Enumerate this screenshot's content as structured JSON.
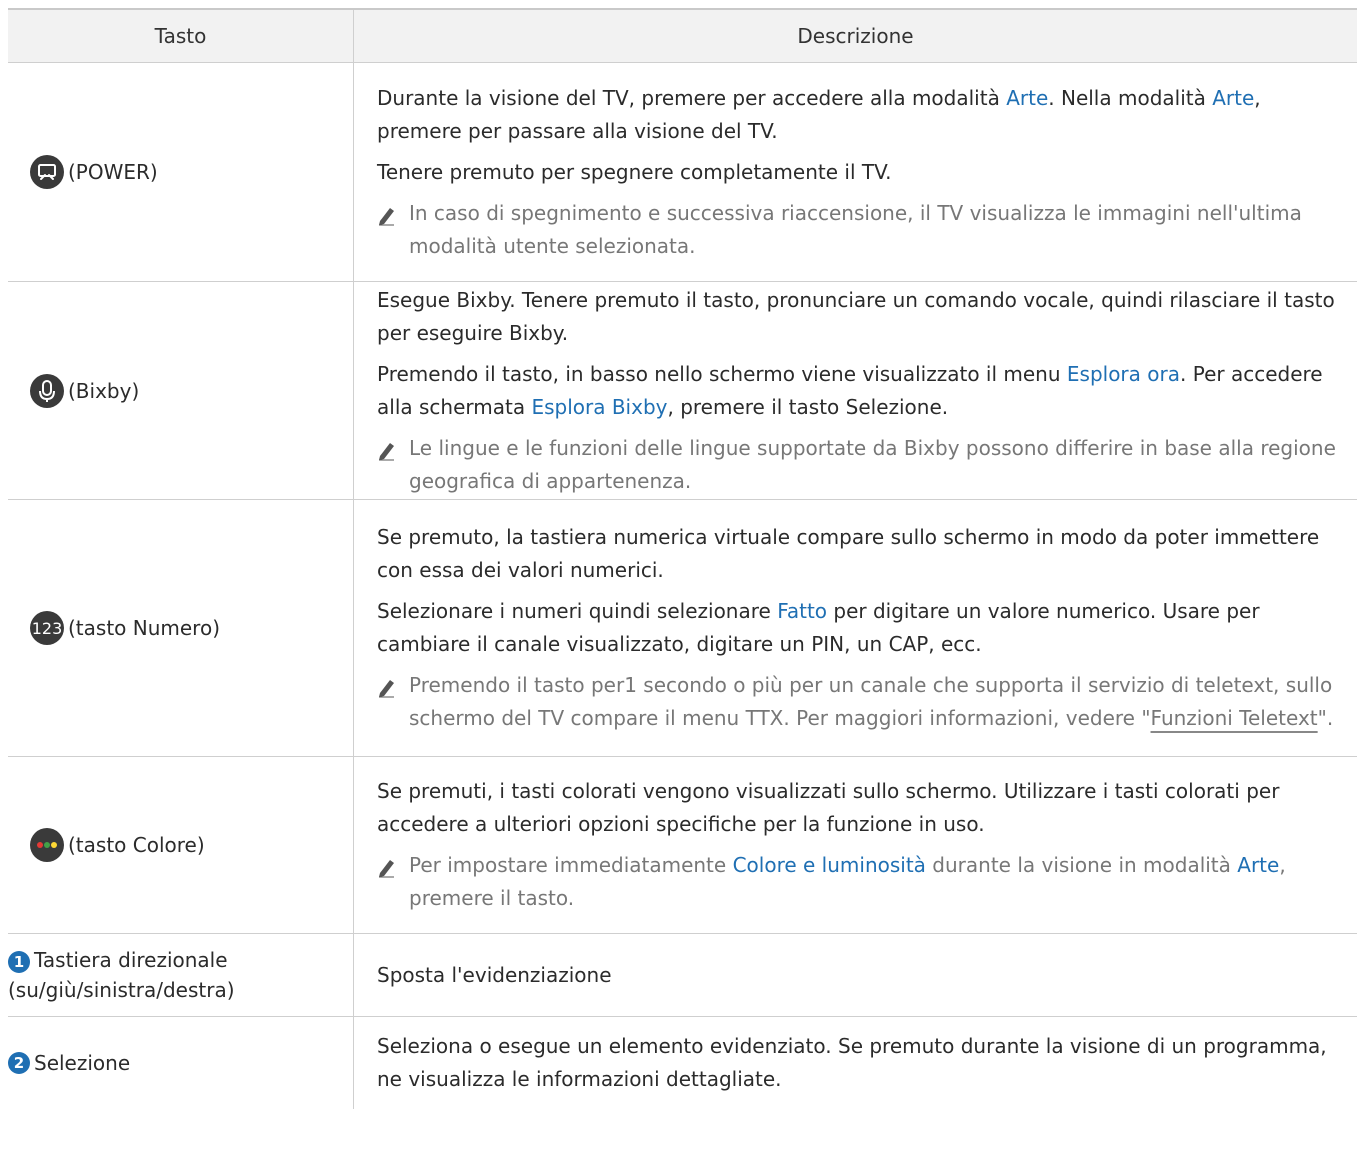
{
  "header": {
    "key_col": "Tasto",
    "desc_col": "Descrizione"
  },
  "rows": [
    {
      "key": "(POWER)",
      "icon": "art-mode-icon",
      "p1_a": "Durante la visione del TV, premere per accedere alla modalità ",
      "p1_link1": "Arte",
      "p1_b": ". Nella modalità ",
      "p1_link2": "Arte",
      "p1_c": ", premere per passare alla visione del TV.",
      "p2": "Tenere premuto per spegnere completamente il TV.",
      "note": "In caso di spegnimento e successiva riaccensione, il TV visualizza le immagini nell'ultima modalità utente selezionata."
    },
    {
      "key": "(Bixby)",
      "icon": "microphone-icon",
      "p1": "Esegue Bixby. Tenere premuto il tasto, pronunciare un comando vocale, quindi rilasciare il tasto per eseguire Bixby.",
      "p2_a": "Premendo il tasto, in basso nello schermo viene visualizzato il menu ",
      "p2_link1": "Esplora ora",
      "p2_b": ". Per accedere alla schermata ",
      "p2_link2": "Esplora Bixby",
      "p2_c": ", premere il tasto Selezione.",
      "note": "Le lingue e le funzioni delle lingue supportate da Bixby possono differire in base alla regione geografica di appartenenza."
    },
    {
      "key": "(tasto Numero)",
      "icon_text": "123",
      "p1": "Se premuto, la tastiera numerica virtuale compare sullo schermo in modo da poter immettere con essa dei valori numerici.",
      "p2_a": "Selezionare i numeri quindi selezionare ",
      "p2_link": "Fatto",
      "p2_b": " per digitare un valore numerico. Usare per cambiare il canale visualizzato, digitare un PIN, un CAP, ecc.",
      "note_a": "Premendo il tasto per1 secondo o più per un canale che supporta il servizio di teletext, sullo schermo del TV compare il menu TTX. Per maggiori informazioni, vedere \"",
      "note_link": "Funzioni Teletext",
      "note_b": "\"."
    },
    {
      "key": "(tasto Colore)",
      "icon": "color-dots-icon",
      "p1": "Se premuti, i tasti colorati vengono visualizzati sullo schermo. Utilizzare i tasti colorati per accedere a ulteriori opzioni specifiche per la funzione in uso.",
      "note_a": "Per impostare immediatamente ",
      "note_link1": "Colore e luminosità",
      "note_b": " durante la visione in modalità ",
      "note_link2": "Arte",
      "note_c": ", premere il tasto."
    },
    {
      "num": "1",
      "key": "Tastiera direzionale (su/giù/sinistra/destra)",
      "p1": "Sposta l'evidenziazione"
    },
    {
      "num": "2",
      "key": "Selezione",
      "p1": "Seleziona o esegue un elemento evidenziato. Se premuto durante la visione di un programma, ne visualizza le informazioni dettagliate."
    }
  ]
}
